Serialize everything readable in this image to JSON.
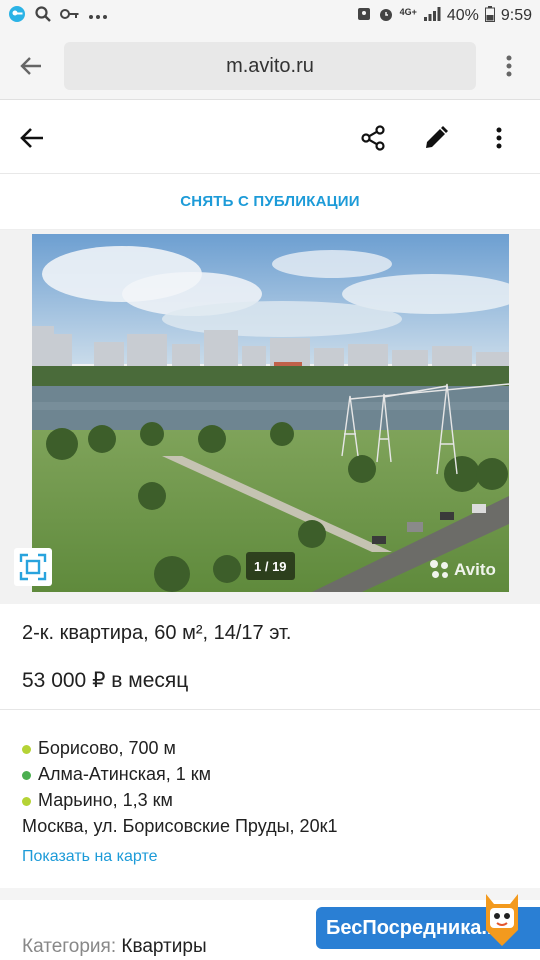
{
  "status_bar": {
    "battery": "40%",
    "time": "9:59",
    "network": "4G+"
  },
  "browser": {
    "url": "m.avito.ru"
  },
  "actions": {
    "unpublish_label": "СНЯТЬ С ПУБЛИКАЦИИ"
  },
  "gallery": {
    "counter": "1 / 19",
    "watermark": "Avito"
  },
  "listing": {
    "title": "2-к. квартира, 60 м², 14/17 эт.",
    "price": "53 000 ₽ в месяц"
  },
  "location": {
    "metro": [
      {
        "name": "Борисово, 700 м",
        "color": "#b5d335"
      },
      {
        "name": "Алма-Атинская, 1 км",
        "color": "#4caf50"
      },
      {
        "name": "Марьино, 1,3 км",
        "color": "#b5d335"
      }
    ],
    "address": "Москва, ул. Борисовские Пруды, 20к1",
    "map_link": "Показать на карте"
  },
  "category": {
    "key": "Категория:",
    "value": "Квартиры"
  },
  "overlay_badge": {
    "text": "БесПосредника.ru"
  },
  "colors": {
    "accent": "#1d9bd8",
    "badge": "#2a7fd4"
  }
}
